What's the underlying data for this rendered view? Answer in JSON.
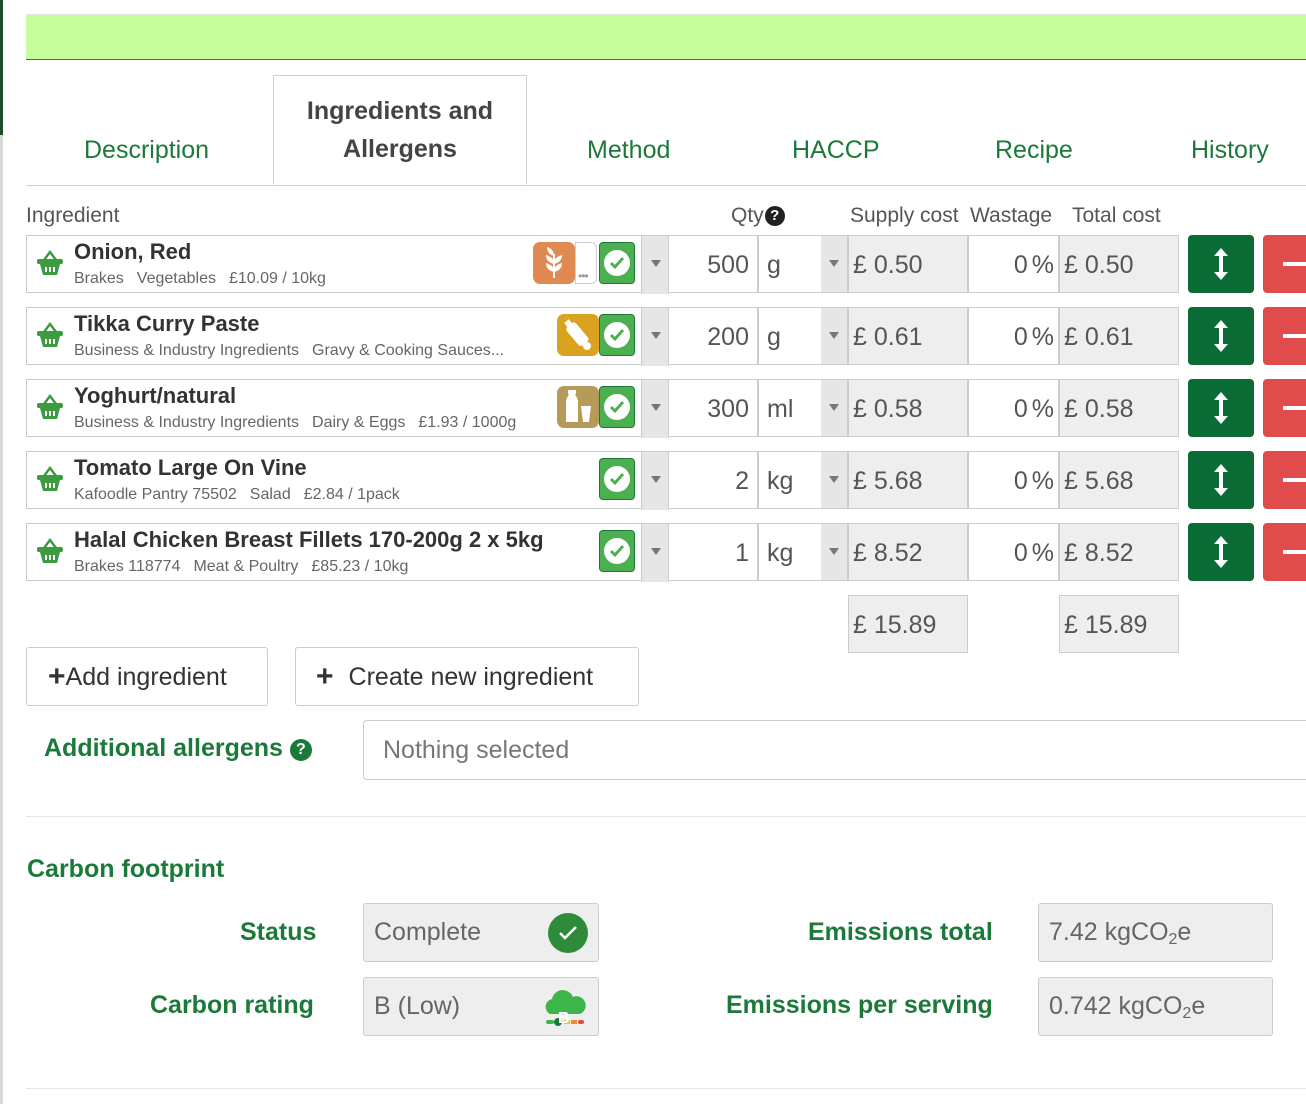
{
  "tabs": {
    "description": "Description",
    "ingredients_line1": "Ingredients and",
    "ingredients_line2": "Allergens",
    "method": "Method",
    "haccp": "HACCP",
    "recipe": "Recipe",
    "history": "History"
  },
  "columns": {
    "ingredient": "Ingredient",
    "qty": "Qty",
    "supply_cost": "Supply cost",
    "wastage": "Wastage",
    "total_cost": "Total cost"
  },
  "ingredients": [
    {
      "name": "Onion, Red",
      "supplier": "Brakes",
      "category": "Vegetables",
      "price": "£10.09 / 10kg",
      "qty": "500",
      "unit": "g",
      "supply_cost": "£ 0.50",
      "wastage": "0",
      "pct": "%",
      "total_cost": "£ 0.50",
      "allergens": [
        "gluten-icon",
        "more-icon"
      ]
    },
    {
      "name": "Tikka Curry Paste",
      "supplier": "Business & Industry Ingredients",
      "category": "Gravy & Cooking Sauces...",
      "price": "",
      "qty": "200",
      "unit": "g",
      "supply_cost": "£ 0.61",
      "wastage": "0",
      "pct": "%",
      "total_cost": "£ 0.61",
      "allergens": [
        "mustard-icon"
      ]
    },
    {
      "name": "Yoghurt/natural",
      "supplier": "Business & Industry Ingredients",
      "category": "Dairy & Eggs",
      "price": "£1.93 / 1000g",
      "qty": "300",
      "unit": "ml",
      "supply_cost": "£ 0.58",
      "wastage": "0",
      "pct": "%",
      "total_cost": "£ 0.58",
      "allergens": [
        "milk-icon"
      ]
    },
    {
      "name": "Tomato Large On Vine",
      "supplier": "Kafoodle Pantry 75502",
      "category": "Salad",
      "price": "£2.84 / 1pack",
      "qty": "2",
      "unit": "kg",
      "supply_cost": "£ 5.68",
      "wastage": "0",
      "pct": "%",
      "total_cost": "£ 5.68",
      "allergens": []
    },
    {
      "name": "Halal Chicken Breast Fillets 170-200g 2 x 5kg",
      "supplier": "Brakes 118774",
      "category": "Meat & Poultry",
      "price": "£85.23 / 10kg",
      "qty": "1",
      "unit": "kg",
      "supply_cost": "£ 8.52",
      "wastage": "0",
      "pct": "%",
      "total_cost": "£ 8.52",
      "allergens": []
    }
  ],
  "totals": {
    "supply_cost": "£ 15.89",
    "total_cost": "£ 15.89"
  },
  "buttons": {
    "add_ingredient": "Add ingredient",
    "create_ingredient": "Create new ingredient"
  },
  "additional_allergens": {
    "label": "Additional allergens",
    "placeholder": "Nothing selected"
  },
  "carbon": {
    "title": "Carbon footprint",
    "status_label": "Status",
    "status_value": "Complete",
    "rating_label": "Carbon rating",
    "rating_value": "B (Low)",
    "rating_badge": "B",
    "emissions_total_label": "Emissions total",
    "emissions_total_value": "7.42",
    "emissions_per_serving_label": "Emissions per serving",
    "emissions_per_serving_value": "0.742",
    "unit_prefix": "kgCO",
    "unit_sub": "2",
    "unit_suffix": "e"
  },
  "colors": {
    "accent_green": "#1b7a3a",
    "banner": "#c6fc9c",
    "move": "#0b6b35",
    "delete": "#e04b4b"
  }
}
